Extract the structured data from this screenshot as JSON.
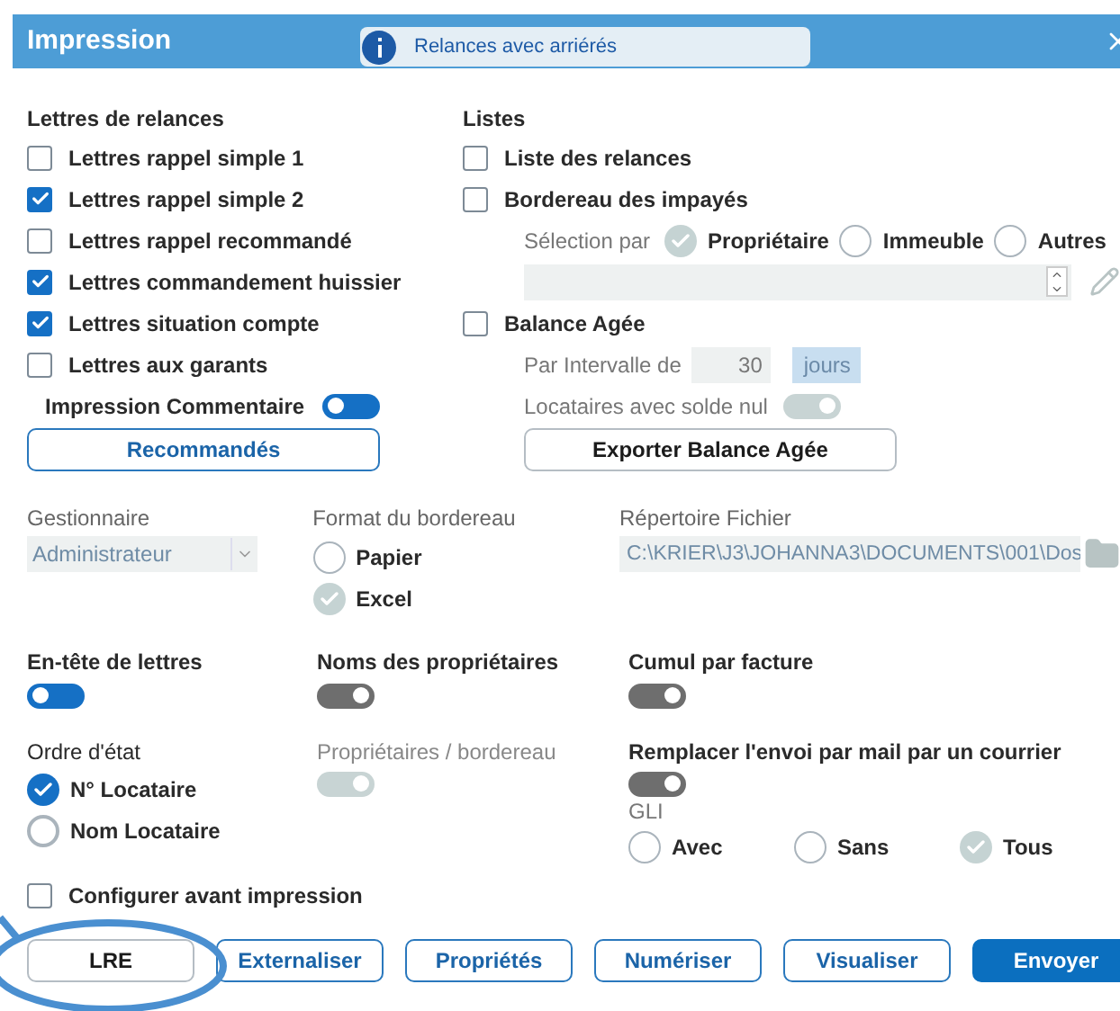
{
  "window": {
    "title": "Impression",
    "info_banner": "Relances avec arriérés"
  },
  "lettres": {
    "heading": "Lettres de relances",
    "items": [
      {
        "label": "Lettres rappel simple 1",
        "checked": false
      },
      {
        "label": "Lettres rappel simple 2",
        "checked": true
      },
      {
        "label": "Lettres rappel recommandé",
        "checked": false
      },
      {
        "label": "Lettres commandement huissier",
        "checked": true
      },
      {
        "label": "Lettres situation compte",
        "checked": true
      },
      {
        "label": "Lettres aux garants",
        "checked": false
      }
    ],
    "comment_toggle": {
      "label": "Impression Commentaire",
      "on": false,
      "disabled": false
    },
    "button": "Recommandés"
  },
  "listes": {
    "heading": "Listes",
    "items": [
      {
        "label": "Liste des relances",
        "checked": false
      },
      {
        "label": "Bordereau des impayés",
        "checked": false
      }
    ],
    "selection": {
      "label": "Sélection par",
      "options": [
        {
          "label": "Propriétaire",
          "selected": true,
          "disabled": true
        },
        {
          "label": "Immeuble",
          "selected": false,
          "disabled": true
        },
        {
          "label": "Autres",
          "selected": false,
          "disabled": true
        }
      ]
    },
    "balance": {
      "label": "Balance Agée",
      "checked": false
    },
    "interval": {
      "label": "Par Intervalle de",
      "value": "30",
      "unit": "jours"
    },
    "zero_balance": {
      "label": "Locataires avec solde nul",
      "on": true,
      "disabled": true
    },
    "export_button": "Exporter Balance Agée"
  },
  "gestionnaire": {
    "label": "Gestionnaire",
    "value": "Administrateur"
  },
  "format": {
    "label": "Format du bordereau",
    "options": [
      {
        "label": "Papier",
        "selected": false,
        "disabled": true
      },
      {
        "label": "Excel",
        "selected": true,
        "disabled": true
      }
    ]
  },
  "directory": {
    "label": "Répertoire Fichier",
    "value": "C:\\KRIER\\J3\\JOHANNA3\\DOCUMENTS\\001\\Dos"
  },
  "toggles": [
    {
      "label": "En-tête de lettres",
      "on": false,
      "disabled": false
    },
    {
      "label": "Noms des propriétaires",
      "on": true,
      "disabled": false
    },
    {
      "label": "Cumul par facture",
      "on": true,
      "disabled": false
    }
  ],
  "ordre": {
    "label": "Ordre d'état",
    "options": [
      {
        "label": "N° Locataire",
        "selected": true,
        "disabled": false
      },
      {
        "label": "Nom Locataire",
        "selected": false,
        "disabled": false
      }
    ]
  },
  "owners_per_slip": {
    "label": "Propriétaires / bordereau",
    "on": true,
    "disabled": true
  },
  "mail_replace": {
    "label": "Remplacer l'envoi par mail par un courrier",
    "on": true,
    "disabled": false
  },
  "gli": {
    "label": "GLI",
    "options": [
      {
        "label": "Avec",
        "selected": false,
        "disabled": true
      },
      {
        "label": "Sans",
        "selected": false,
        "disabled": true
      },
      {
        "label": "Tous",
        "selected": true,
        "disabled": true
      }
    ]
  },
  "configure": {
    "label": "Configurer avant impression",
    "checked": false
  },
  "buttons": [
    {
      "label": "LRE",
      "kind": "plain"
    },
    {
      "label": "Externaliser",
      "kind": "outline"
    },
    {
      "label": "Propriétés",
      "kind": "outline"
    },
    {
      "label": "Numériser",
      "kind": "outline"
    },
    {
      "label": "Visualiser",
      "kind": "outline"
    },
    {
      "label": "Envoyer",
      "kind": "primary"
    }
  ]
}
